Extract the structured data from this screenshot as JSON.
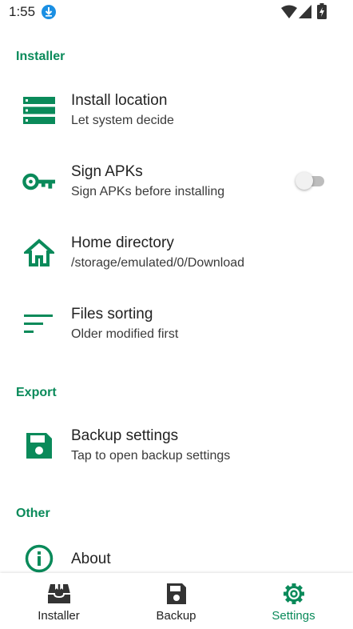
{
  "status_bar": {
    "time": "1:55"
  },
  "colors": {
    "accent": "#0a8a5a",
    "text": "#222222",
    "toggle_off": "#bdbdbd"
  },
  "sections": {
    "installer": "Installer",
    "export": "Export",
    "other": "Other"
  },
  "prefs": {
    "install_location": {
      "title": "Install location",
      "summary": "Let system decide",
      "icon": "storage-icon"
    },
    "sign_apks": {
      "title": "Sign APKs",
      "summary": "Sign APKs before installing",
      "icon": "key-icon",
      "toggle": false
    },
    "home_directory": {
      "title": "Home directory",
      "summary": "/storage/emulated/0/Download",
      "icon": "home-icon"
    },
    "files_sorting": {
      "title": "Files sorting",
      "summary": "Older modified first",
      "icon": "sort-icon"
    },
    "backup_settings": {
      "title": "Backup settings",
      "summary": "Tap to open backup settings",
      "icon": "floppy-icon"
    },
    "about": {
      "title": "About",
      "icon": "info-icon"
    }
  },
  "bottom_nav": [
    {
      "label": "Installer",
      "icon": "installer-icon",
      "active": false
    },
    {
      "label": "Backup",
      "icon": "backup-icon",
      "active": false
    },
    {
      "label": "Settings",
      "icon": "gear-icon",
      "active": true
    }
  ]
}
